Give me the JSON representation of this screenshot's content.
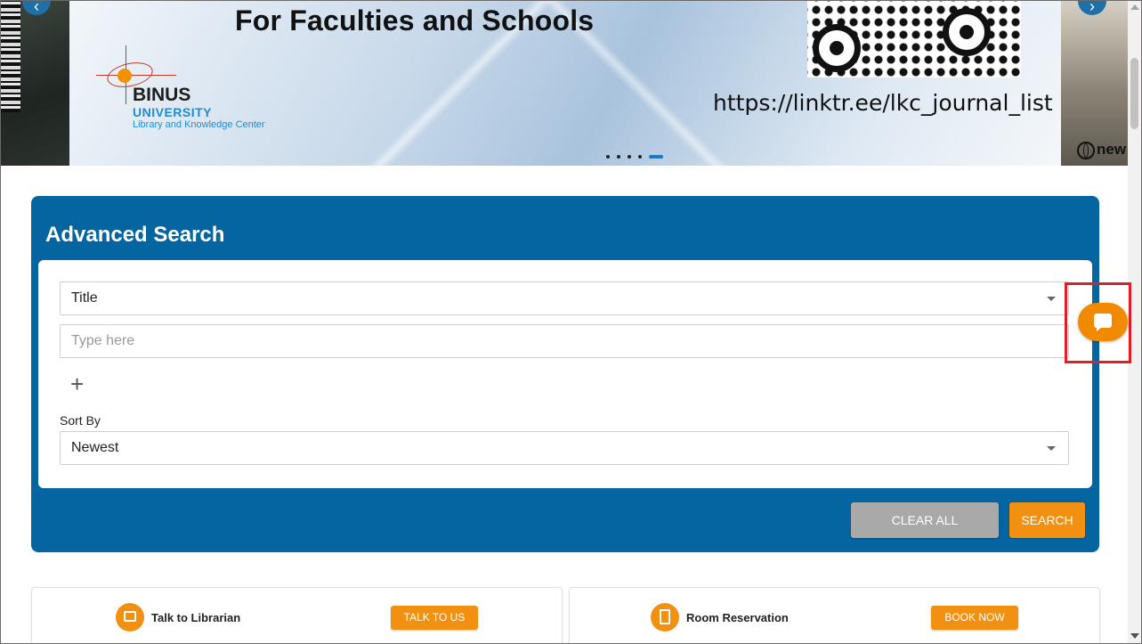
{
  "banner": {
    "title": "For Faculties and Schools",
    "url_text": "https://linktr.ee/lkc_journal_list",
    "logo": {
      "name": "BINUS",
      "university": "UNIVERSITY",
      "subtitle": "Library and Knowledge Center"
    },
    "next_slide_text": "new",
    "slide_count": 5,
    "active_slide": 5
  },
  "advanced_search": {
    "title": "Advanced Search",
    "field_select": "Title",
    "query_placeholder": "Type here",
    "query_value": "",
    "add_icon": "+",
    "sort_label": "Sort By",
    "sort_value": "Newest",
    "clear_label": "CLEAR ALL",
    "search_label": "SEARCH"
  },
  "cards": [
    {
      "label": "Talk to Librarian",
      "cta": "TALK TO US",
      "icon": "chat-icon"
    },
    {
      "label": "Room Reservation",
      "cta": "BOOK NOW",
      "icon": "document-icon"
    }
  ],
  "chat_widget": {
    "icon": "chat-bubble-icon",
    "highlighted": true
  },
  "colors": {
    "primary_blue": "#0565a0",
    "accent_orange": "#f29111",
    "clear_gray": "#a9a9a9",
    "highlight_red": "#e01e26"
  }
}
